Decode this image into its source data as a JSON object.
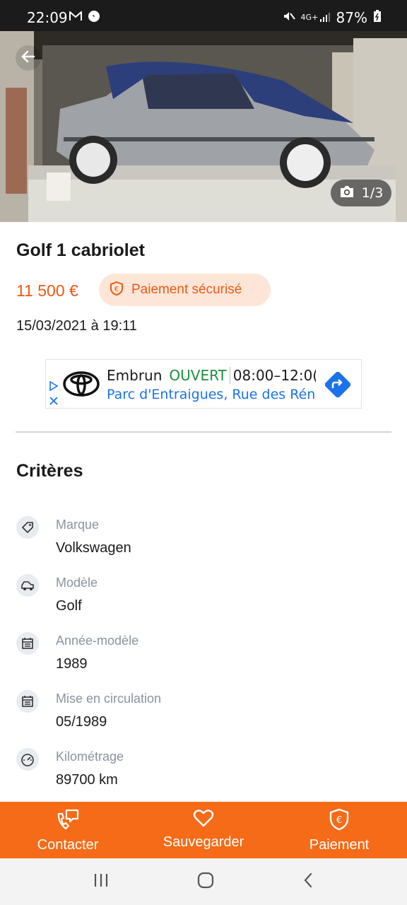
{
  "status_bar": {
    "time": "22:09",
    "network": "4G+",
    "battery": "87%",
    "icons": [
      "gmail-icon",
      "messenger-icon",
      "mute-icon",
      "signal-icon",
      "battery-icon"
    ]
  },
  "gallery": {
    "counter": "1/3"
  },
  "listing": {
    "title": "Golf 1 cabriolet",
    "price": "11 500 €",
    "secure_payment": "Paiement sécurisé",
    "date": "15/03/2021 à 19:11"
  },
  "ad": {
    "business": "Embrun",
    "status": "OUVERT",
    "hours": "08:00–12:0(",
    "address": "Parc d'Entraigues, Rue des Rén"
  },
  "criteria": {
    "title": "Critères",
    "items": [
      {
        "label": "Marque",
        "value": "Volkswagen",
        "icon": "tag-icon"
      },
      {
        "label": "Modèle",
        "value": "Golf",
        "icon": "car-icon"
      },
      {
        "label": "Année-modèle",
        "value": "1989",
        "icon": "calendar-icon"
      },
      {
        "label": "Mise en circulation",
        "value": "05/1989",
        "icon": "calendar-icon"
      },
      {
        "label": "Kilométrage",
        "value": "89700 km",
        "icon": "speedometer-icon"
      }
    ]
  },
  "actions": {
    "contact": "Contacter",
    "save": "Sauvegarder",
    "payment": "Paiement"
  },
  "colors": {
    "accent": "#f56b17",
    "price": "#ec5a13",
    "badge_bg": "#fde6d8",
    "ad_open": "#1e8e3e",
    "ad_link": "#1a73e8"
  }
}
